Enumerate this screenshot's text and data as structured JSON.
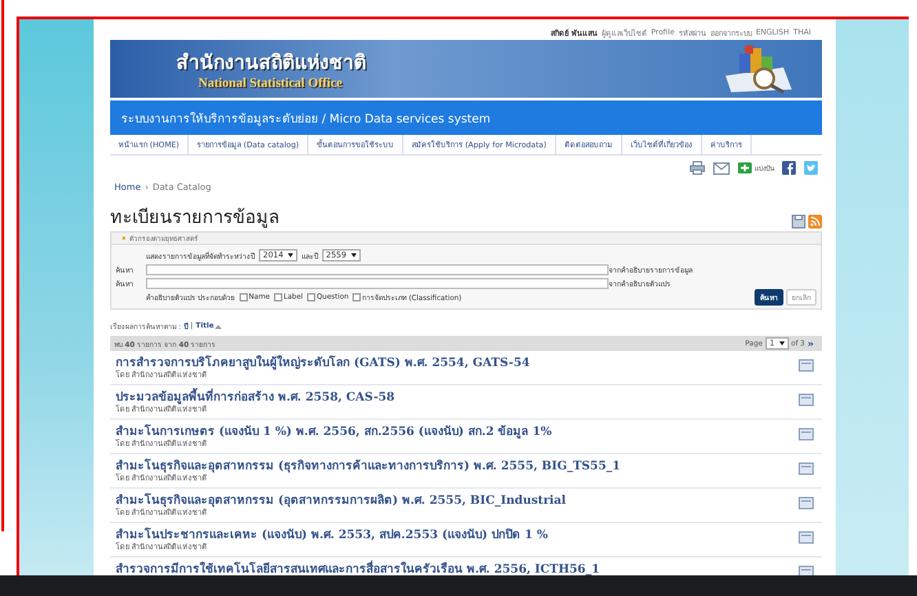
{
  "top_links": {
    "user": "สกิดย์ พันแสน",
    "links": [
      "ผู้ดูแลเว็บไซต์",
      "Profile",
      "รหัสผ่าน",
      "ออกจากระบบ",
      "ENGLISH",
      "THAI"
    ]
  },
  "banner": {
    "title_thai": "สำนักงานสถิติแห่งชาติ",
    "title_english": "National Statistical Office"
  },
  "system_bar": {
    "title": "ระบบงานการให้บริการข้อมูลระดับย่อย / Micro Data services system"
  },
  "nav": [
    "หน้าแรก (HOME)",
    "รายการข้อมูล (Data catalog)",
    "ขั้นตอนการขอใช้ระบบ",
    "สมัครใช้บริการ (Apply for Microdata)",
    "ติดต่อสอบถาม",
    "เว็บไซต์ที่เกี่ยวข้อง",
    "ค่าบริการ"
  ],
  "share": {
    "label": "แบ่งปัน"
  },
  "breadcrumb": {
    "items": [
      "Home",
      "Data Catalog"
    ],
    "separator": "›"
  },
  "page_title": "ทะเบียนรายการข้อมูล",
  "filter": {
    "header": "ตัวกรองตามยุทธศาสตร์",
    "year_label": "แสดงรายการข้อมูลที่จัดทำระหว่างปี",
    "year_from": "2014",
    "and_label": "และปี",
    "year_to": "2559",
    "search_rows": [
      {
        "label": "ค้นหา",
        "hint": "จากคำอธิบายรายการข้อมูล"
      },
      {
        "label": "ค้นหา",
        "hint": "จากคำอธิบายตัวแปร"
      }
    ],
    "variable_label": "คำอธิบายตัวแปร ประกอบด้วย",
    "options": [
      {
        "label": "Name",
        "checked": false
      },
      {
        "label": "Label",
        "checked": false
      },
      {
        "label": "Question",
        "checked": false
      },
      {
        "label": "การจัดประเภท (Classification)",
        "checked": false
      }
    ],
    "buttons": [
      {
        "label": "ค้นหา",
        "kind": "primary"
      },
      {
        "label": "ยกเลิก",
        "kind": "secondary"
      }
    ]
  },
  "sort": {
    "label": "เรียงผลการค้นหาตาม :",
    "separator": "|",
    "options": [
      {
        "label": "ปี",
        "selected": false
      },
      {
        "label": "Title",
        "selected": true
      }
    ]
  },
  "results": {
    "summary": "พบ **40** รายการ จาก **40** รายการ",
    "page_label": "Page",
    "page": "1",
    "of_label": "of 3",
    "next": "»",
    "items": [
      {
        "title": "การสำรวจการบริโภคยาสูบในผู้ใหญ่ระดับโลก (GATS) พ.ศ. 2554, GATS-54",
        "by": "โดย สำนักงานสถิติแห่งชาติ"
      },
      {
        "title": "ประมวลข้อมูลพื้นที่การก่อสร้าง พ.ศ. 2558, CAS-58",
        "by": "โดย สำนักงานสถิติแห่งชาติ"
      },
      {
        "title": "สำมะโนการเกษตร (แจงนับ 1 %) พ.ศ. 2556, สก.2556 (แจงนับ) สก.2 ข้อมูล 1%",
        "by": "โดย สำนักงานสถิติแห่งชาติ"
      },
      {
        "title": "สำมะโนธุรกิจและอุตสาหกรรม (ธุรกิจทางการค้าและทางการบริการ) พ.ศ. 2555, BIG_TS55_1",
        "by": "โดย สำนักงานสถิติแห่งชาติ"
      },
      {
        "title": "สำมะโนธุรกิจและอุตสาหกรรม (อุตสาหกรรมการผลิต) พ.ศ. 2555, BIC_Industrial",
        "by": "โดย สำนักงานสถิติแห่งชาติ"
      },
      {
        "title": "สำมะโนประชากรและเคหะ (แจงนับ) พ.ศ. 2553, สปค.2553 (แจงนับ) ปกปิด 1 %",
        "by": "โดย สำนักงานสถิติแห่งชาติ"
      },
      {
        "title": "สำรวจการมีการใช้เทคโนโลยีสารสนเทศและการสื่อสารในครัวเรือน พ.ศ. 2556, ICTH56_1"
      }
    ]
  }
}
